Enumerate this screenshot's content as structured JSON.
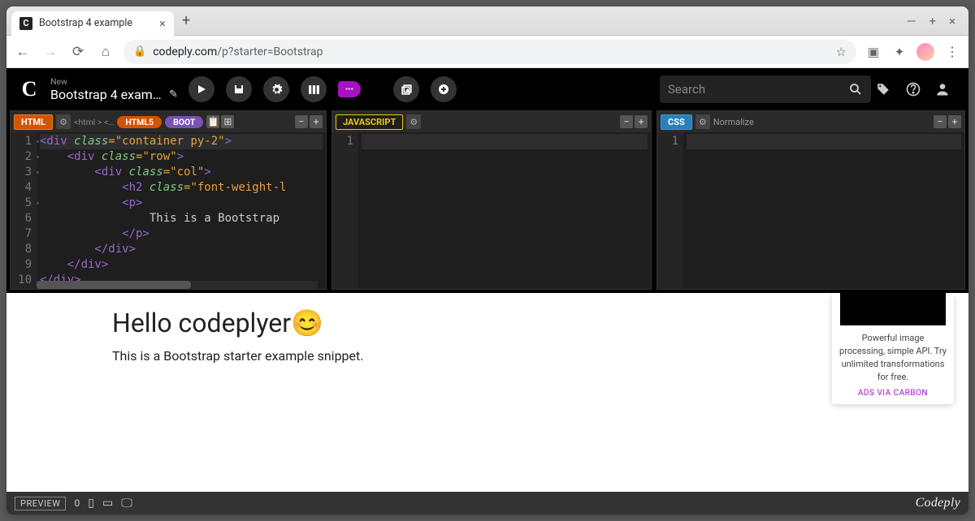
{
  "browser": {
    "tab_title": "Bootstrap 4 example",
    "url_host": "codeply.com",
    "url_path": "/p?starter=Bootstrap"
  },
  "app": {
    "title_small": "New",
    "title": "Bootstrap 4 examp…",
    "search_placeholder": "Search"
  },
  "panels": {
    "html": {
      "label": "HTML",
      "breadcrumb": "<html > <…",
      "pill_html5": "HTML5",
      "pill_boot": "BOOT",
      "lines": [
        "1",
        "2",
        "3",
        "4",
        "5",
        "6",
        "7",
        "8",
        "9",
        "10"
      ],
      "code": {
        "l1": {
          "a": "<div",
          "b": " class",
          "c": "=\"container py-2\"",
          "d": ">"
        },
        "l2": {
          "a": "    <div",
          "b": " class",
          "c": "=\"row\"",
          "d": ">"
        },
        "l3": {
          "a": "        <div",
          "b": " class",
          "c": "=\"col\"",
          "d": ">"
        },
        "l4": {
          "a": "            <h2",
          "b": " class",
          "c": "=\"font-weight-l",
          "d": ""
        },
        "l5": {
          "a": "            <p>",
          "b": "",
          "c": "",
          "d": ""
        },
        "l6": {
          "a": "                ",
          "txt": "This is a Bootstrap"
        },
        "l7": {
          "a": "            </p>"
        },
        "l8": {
          "a": "        </div>"
        },
        "l9": {
          "a": "    </div>"
        },
        "l10": {
          "a": "</div>"
        }
      }
    },
    "js": {
      "label": "JAVASCRIPT",
      "lines": [
        "1"
      ]
    },
    "css": {
      "label": "CSS",
      "normalize": "Normalize",
      "lines": [
        "1"
      ]
    }
  },
  "preview": {
    "heading": "Hello codeplyer😊",
    "paragraph": "This is a Bootstrap starter example snippet."
  },
  "ad": {
    "text": "Powerful image processing, simple API. Try unlimited transformations for free.",
    "link": "ADS VIA CARBON"
  },
  "bottom": {
    "preview_label": "PREVIEW",
    "count": "0",
    "brand": "Codeply"
  }
}
